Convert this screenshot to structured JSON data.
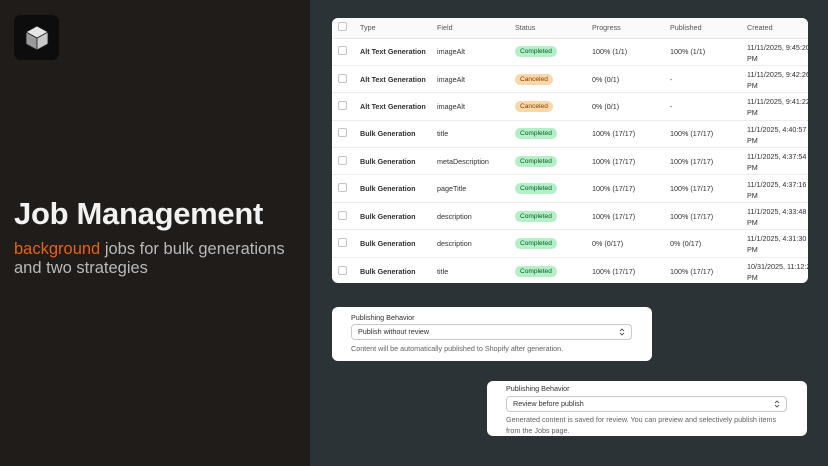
{
  "hero": {
    "title": "Job Management",
    "subtitle_accent": "background",
    "subtitle_rest": " jobs for bulk generations and two strategies",
    "accent_color": "#e8620f"
  },
  "table": {
    "headers": [
      "Type",
      "Field",
      "Status",
      "Progress",
      "Published",
      "Created"
    ],
    "rows": [
      {
        "type": "Alt Text Generation",
        "field": "imageAlt",
        "status": "Completed",
        "progress": "100% (1/1)",
        "published": "100% (1/1)",
        "created_1": "11/11/2025, 9:45:20",
        "created_2": "PM"
      },
      {
        "type": "Alt Text Generation",
        "field": "imageAlt",
        "status": "Canceled",
        "progress": "0% (0/1)",
        "published": "-",
        "created_1": "11/11/2025, 9:42:26",
        "created_2": "PM"
      },
      {
        "type": "Alt Text Generation",
        "field": "imageAlt",
        "status": "Canceled",
        "progress": "0% (0/1)",
        "published": "-",
        "created_1": "11/11/2025, 9:41:22",
        "created_2": "PM"
      },
      {
        "type": "Bulk Generation",
        "field": "title",
        "status": "Completed",
        "progress": "100% (17/17)",
        "published": "100% (17/17)",
        "created_1": "11/1/2025, 4:40:57",
        "created_2": "PM"
      },
      {
        "type": "Bulk Generation",
        "field": "metaDescription",
        "status": "Completed",
        "progress": "100% (17/17)",
        "published": "100% (17/17)",
        "created_1": "11/1/2025, 4:37:54",
        "created_2": "PM"
      },
      {
        "type": "Bulk Generation",
        "field": "pageTitle",
        "status": "Completed",
        "progress": "100% (17/17)",
        "published": "100% (17/17)",
        "created_1": "11/1/2025, 4:37:16",
        "created_2": "PM"
      },
      {
        "type": "Bulk Generation",
        "field": "description",
        "status": "Completed",
        "progress": "100% (17/17)",
        "published": "100% (17/17)",
        "created_1": "11/1/2025, 4:33:48",
        "created_2": "PM"
      },
      {
        "type": "Bulk Generation",
        "field": "description",
        "status": "Completed",
        "progress": "0% (0/17)",
        "published": "0% (0/17)",
        "created_1": "11/1/2025, 4:31:30",
        "created_2": "PM"
      },
      {
        "type": "Bulk Generation",
        "field": "title",
        "status": "Completed",
        "progress": "100% (17/17)",
        "published": "100% (17/17)",
        "created_1": "10/31/2025, 11:12:2",
        "created_2": "PM"
      }
    ]
  },
  "publishing_one": {
    "label": "Publishing Behavior",
    "selected": "Publish without review",
    "help": "Content will be automatically published to Shopify after generation."
  },
  "publishing_two": {
    "label": "Publishing Behavior",
    "selected": "Review before publish",
    "help": "Generated content is saved for review. You can preview and selectively publish items from the Jobs page."
  },
  "colors": {
    "left_bg": "#1f1c1a",
    "right_bg": "#2c3336",
    "completed_bg": "#b4f0c6",
    "canceled_bg": "#fbd7a9"
  },
  "icons": {
    "logo": "cube-icon",
    "select_chevron": "chevron-up-down-icon"
  }
}
